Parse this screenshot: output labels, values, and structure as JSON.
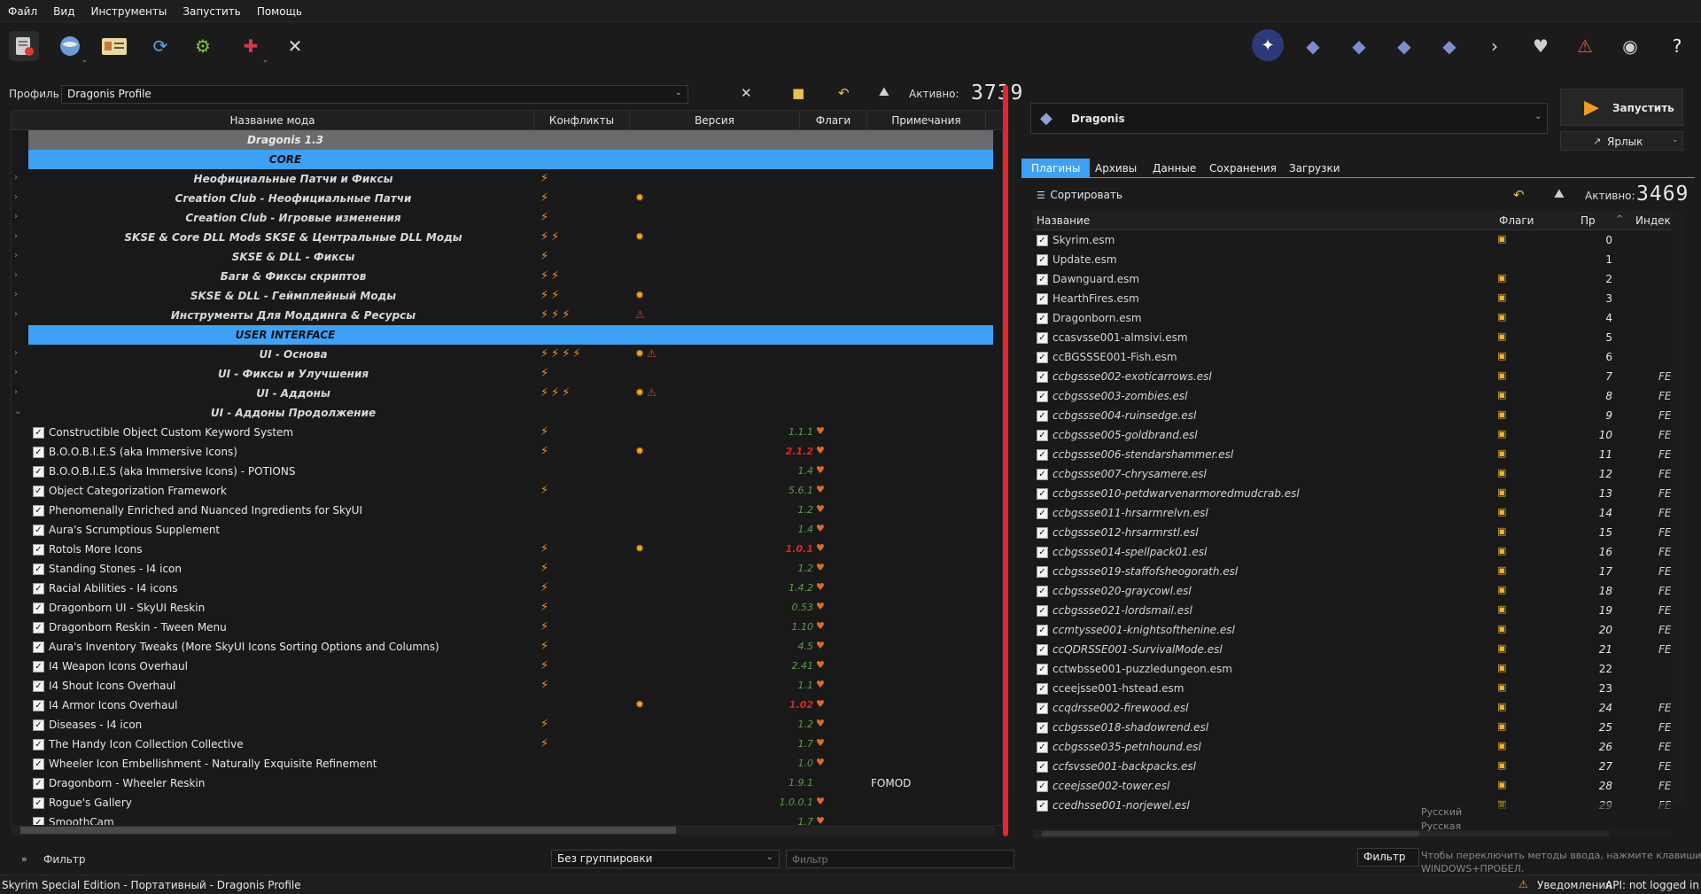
{
  "menu": [
    "Файл",
    "Вид",
    "Инструменты",
    "Запустить",
    "Помощь"
  ],
  "toolbar": {
    "left_icons": [
      "install-mod-icon",
      "nexus-globe-icon",
      "profiles-icon",
      "refresh-icon",
      "settings-gears-icon",
      "plugin-puzzle-icon",
      "tools-icon"
    ],
    "right_icons": [
      "avatar-icon",
      "diamond-icon-1",
      "diamond-icon-2",
      "diamond-icon-3",
      "diamond-icon-4",
      "chevron-icon",
      "heart-icon",
      "warning-icon",
      "globe-person-icon",
      "help-icon"
    ]
  },
  "profile": {
    "label": "Профиль",
    "value": "Dragonis Profile",
    "active_label": "Активно:",
    "active_count": "3739"
  },
  "modlist": {
    "headers": [
      "Название мода",
      "Конфликты",
      "Версия",
      "Флаги",
      "Примечания"
    ],
    "rows": [
      {
        "type": "collection",
        "name": "Dragonis 1.3"
      },
      {
        "type": "category",
        "name": "CORE"
      },
      {
        "type": "sep",
        "name": "Неофициальные Патчи и Фиксы",
        "conf": "⚡",
        "flags": ""
      },
      {
        "type": "sep",
        "name": "Creation Club - Неофициальные Патчи",
        "conf": "⚡",
        "flags": "✹"
      },
      {
        "type": "sep",
        "name": "Creation Club - Игровые изменения",
        "conf": "⚡",
        "flags": ""
      },
      {
        "type": "sep",
        "name": "SKSE & Core DLL Mods SKSE & Центральные DLL Моды",
        "conf": "⚡⚡",
        "flags": "✹"
      },
      {
        "type": "sep",
        "name": "SKSE & DLL - Фиксы",
        "conf": "⚡",
        "flags": ""
      },
      {
        "type": "sep",
        "name": "Баги & Фиксы скриптов",
        "conf": "⚡⚡",
        "flags": ""
      },
      {
        "type": "sep",
        "name": "SKSE & DLL - Геймплейный Моды",
        "conf": "⚡⚡",
        "flags": "✹"
      },
      {
        "type": "sep",
        "name": "Инструменты Для Моддинга & Ресурсы",
        "conf": "⚡⚡⚡",
        "flags": "⚠"
      },
      {
        "type": "category",
        "name": "USER INTERFACE"
      },
      {
        "type": "sep",
        "name": "UI - Основа",
        "conf": "⚡⚡⚡⚡",
        "flags": "✹⚠"
      },
      {
        "type": "sep",
        "name": "UI - Фиксы и Улучшения",
        "conf": "⚡",
        "flags": ""
      },
      {
        "type": "sep",
        "name": "UI - Аддоны",
        "conf": "⚡⚡⚡",
        "flags": "✹⚠"
      },
      {
        "type": "sep-open",
        "name": "UI - Аддоны Продолжение",
        "conf": "",
        "flags": ""
      },
      {
        "type": "mod",
        "name": "Constructible Object Custom Keyword System",
        "conf": "⚡",
        "flags": "",
        "version": "1.1.1",
        "old": false,
        "notes": ""
      },
      {
        "type": "mod",
        "name": "B.O.O.B.I.E.S (aka Immersive Icons)",
        "conf": "⚡",
        "flags": "✹",
        "version": "2.1.2",
        "old": true,
        "notes": ""
      },
      {
        "type": "mod",
        "name": "B.O.O.B.I.E.S (aka Immersive Icons) - POTIONS",
        "conf": "",
        "flags": "",
        "version": "1.4",
        "old": false,
        "notes": ""
      },
      {
        "type": "mod",
        "name": "Object Categorization Framework",
        "conf": "⚡",
        "flags": "",
        "version": "5.6.1",
        "old": false,
        "notes": ""
      },
      {
        "type": "mod",
        "name": "Phenomenally Enriched and Nuanced Ingredients for SkyUI",
        "conf": "",
        "flags": "",
        "version": "1.2",
        "old": false,
        "notes": ""
      },
      {
        "type": "mod",
        "name": "Aura's Scrumptious Supplement",
        "conf": "",
        "flags": "",
        "version": "1.4",
        "old": false,
        "notes": ""
      },
      {
        "type": "mod",
        "name": "Rotols More Icons",
        "conf": "⚡",
        "flags": "✹",
        "version": "1.0.1",
        "old": true,
        "notes": ""
      },
      {
        "type": "mod",
        "name": "Standing Stones - I4 icon",
        "conf": "⚡",
        "flags": "",
        "version": "1.2",
        "old": false,
        "notes": ""
      },
      {
        "type": "mod",
        "name": "Racial Abilities - I4 icons",
        "conf": "⚡",
        "flags": "",
        "version": "1.4.2",
        "old": false,
        "notes": ""
      },
      {
        "type": "mod",
        "name": "Dragonborn UI - SkyUI Reskin",
        "conf": "⚡",
        "flags": "",
        "version": "0.53",
        "old": false,
        "notes": ""
      },
      {
        "type": "mod",
        "name": "Dragonborn Reskin - Tween Menu",
        "conf": "⚡",
        "flags": "",
        "version": "1.10",
        "old": false,
        "notes": ""
      },
      {
        "type": "mod",
        "name": "Aura's Inventory Tweaks (More SkyUI Icons Sorting Options and Columns)",
        "conf": "⚡",
        "flags": "",
        "version": "4.5",
        "old": false,
        "notes": ""
      },
      {
        "type": "mod",
        "name": "I4 Weapon Icons Overhaul",
        "conf": "⚡",
        "flags": "",
        "version": "2.41",
        "old": false,
        "notes": ""
      },
      {
        "type": "mod",
        "name": "I4 Shout Icons Overhaul",
        "conf": "⚡",
        "flags": "",
        "version": "1.1",
        "old": false,
        "notes": ""
      },
      {
        "type": "mod",
        "name": "I4 Armor Icons Overhaul",
        "conf": "",
        "flags": "✹",
        "version": "1.02",
        "old": true,
        "notes": ""
      },
      {
        "type": "mod",
        "name": "Diseases - I4 icon",
        "conf": "⚡",
        "flags": "",
        "version": "1.2",
        "old": false,
        "notes": ""
      },
      {
        "type": "mod",
        "name": "The Handy Icon Collection Collective",
        "conf": "⚡",
        "flags": "",
        "version": "1.7",
        "old": false,
        "notes": ""
      },
      {
        "type": "mod",
        "name": "Wheeler Icon Embellishment - Naturally Exquisite Refinement",
        "conf": "",
        "flags": "",
        "version": "1.0",
        "old": false,
        "notes": ""
      },
      {
        "type": "mod",
        "name": "Dragonborn - Wheeler Reskin",
        "conf": "",
        "flags": "",
        "version": "1.9.1",
        "old": false,
        "notes": "FOMOD"
      },
      {
        "type": "mod",
        "name": "Rogue's Gallery",
        "conf": "",
        "flags": "",
        "version": "1.0.0.1",
        "old": false,
        "notes": ""
      },
      {
        "type": "mod",
        "name": "SmoothCam",
        "conf": "",
        "flags": "",
        "version": "1.7",
        "old": false,
        "notes": ""
      }
    ]
  },
  "bottom_left": {
    "filter_label": "Фильтр",
    "grouping": "Без группировки",
    "filter_placeholder": "Фильтр"
  },
  "launcher": {
    "exe": "Dragonis",
    "run_label": "Запустить",
    "shortcut_label": "Ярлык"
  },
  "tabs": [
    "Плагины",
    "Архивы",
    "Данные",
    "Сохранения",
    "Загрузки"
  ],
  "plugins": {
    "sort_label": "Сортировать",
    "active_label": "Активно:",
    "active_count": "3469",
    "headers": [
      "Название",
      "Флаги",
      "Пр",
      "Индекс"
    ],
    "rows": [
      {
        "name": "Skyrim.esm",
        "pri": "0",
        "idx": "",
        "it": false
      },
      {
        "name": "Update.esm",
        "pri": "1",
        "idx": "",
        "it": false
      },
      {
        "name": "Dawnguard.esm",
        "pri": "2",
        "idx": "",
        "it": false
      },
      {
        "name": "HearthFires.esm",
        "pri": "3",
        "idx": "",
        "it": false
      },
      {
        "name": "Dragonborn.esm",
        "pri": "4",
        "idx": "",
        "it": false
      },
      {
        "name": "ccasvsse001-almsivi.esm",
        "pri": "5",
        "idx": "",
        "it": false
      },
      {
        "name": "ccBGSSSE001-Fish.esm",
        "pri": "6",
        "idx": "",
        "it": false
      },
      {
        "name": "ccbgssse002-exoticarrows.esl",
        "pri": "7",
        "idx": "FE",
        "it": true
      },
      {
        "name": "ccbgssse003-zombies.esl",
        "pri": "8",
        "idx": "FE",
        "it": true
      },
      {
        "name": "ccbgssse004-ruinsedge.esl",
        "pri": "9",
        "idx": "FE",
        "it": true
      },
      {
        "name": "ccbgssse005-goldbrand.esl",
        "pri": "10",
        "idx": "FE",
        "it": true
      },
      {
        "name": "ccbgssse006-stendarshammer.esl",
        "pri": "11",
        "idx": "FE",
        "it": true
      },
      {
        "name": "ccbgssse007-chrysamere.esl",
        "pri": "12",
        "idx": "FE",
        "it": true
      },
      {
        "name": "ccbgssse010-petdwarvenarmoredmudcrab.esl",
        "pri": "13",
        "idx": "FE",
        "it": true
      },
      {
        "name": "ccbgssse011-hrsarmrelvn.esl",
        "pri": "14",
        "idx": "FE",
        "it": true
      },
      {
        "name": "ccbgssse012-hrsarmrstl.esl",
        "pri": "15",
        "idx": "FE",
        "it": true
      },
      {
        "name": "ccbgssse014-spellpack01.esl",
        "pri": "16",
        "idx": "FE",
        "it": true
      },
      {
        "name": "ccbgssse019-staffofsheogorath.esl",
        "pri": "17",
        "idx": "FE",
        "it": true
      },
      {
        "name": "ccbgssse020-graycowl.esl",
        "pri": "18",
        "idx": "FE",
        "it": true
      },
      {
        "name": "ccbgssse021-lordsmail.esl",
        "pri": "19",
        "idx": "FE",
        "it": true
      },
      {
        "name": "ccmtysse001-knightsofthenine.esl",
        "pri": "20",
        "idx": "FE",
        "it": true
      },
      {
        "name": "ccQDRSSE001-SurvivalMode.esl",
        "pri": "21",
        "idx": "FE",
        "it": true
      },
      {
        "name": "cctwbsse001-puzzledungeon.esm",
        "pri": "22",
        "idx": "",
        "it": false
      },
      {
        "name": "cceejsse001-hstead.esm",
        "pri": "23",
        "idx": "",
        "it": false
      },
      {
        "name": "ccqdrsse002-firewood.esl",
        "pri": "24",
        "idx": "FE",
        "it": true
      },
      {
        "name": "ccbgssse018-shadowrend.esl",
        "pri": "25",
        "idx": "FE",
        "it": true
      },
      {
        "name": "ccbgssse035-petnhound.esl",
        "pri": "26",
        "idx": "FE",
        "it": true
      },
      {
        "name": "ccfsvsse001-backpacks.esl",
        "pri": "27",
        "idx": "FE",
        "it": true
      },
      {
        "name": "cceejsse002-tower.esl",
        "pri": "28",
        "idx": "FE",
        "it": true
      },
      {
        "name": "ccedhsse001-norjewel.esl",
        "pri": "29",
        "idx": "FE",
        "it": true
      }
    ]
  },
  "bottom_right": {
    "filter_label": "Фильтр",
    "lang_line1": "Русский",
    "lang_line2": "Русская",
    "hint_line1": "Чтобы переключить методы ввода, нажмите клавиши",
    "hint_line2": "WINDOWS+ПРОБЕЛ."
  },
  "status": {
    "left": "Skyrim Special Edition - Портативный - Dragonis Profile",
    "notifications": "Уведомления",
    "api": "API: not logged in"
  },
  "colors": {
    "accent": "#3da1f5",
    "version_ok": "#5a9f46",
    "version_old": "#e0231f",
    "annotation": "#e8232a"
  }
}
